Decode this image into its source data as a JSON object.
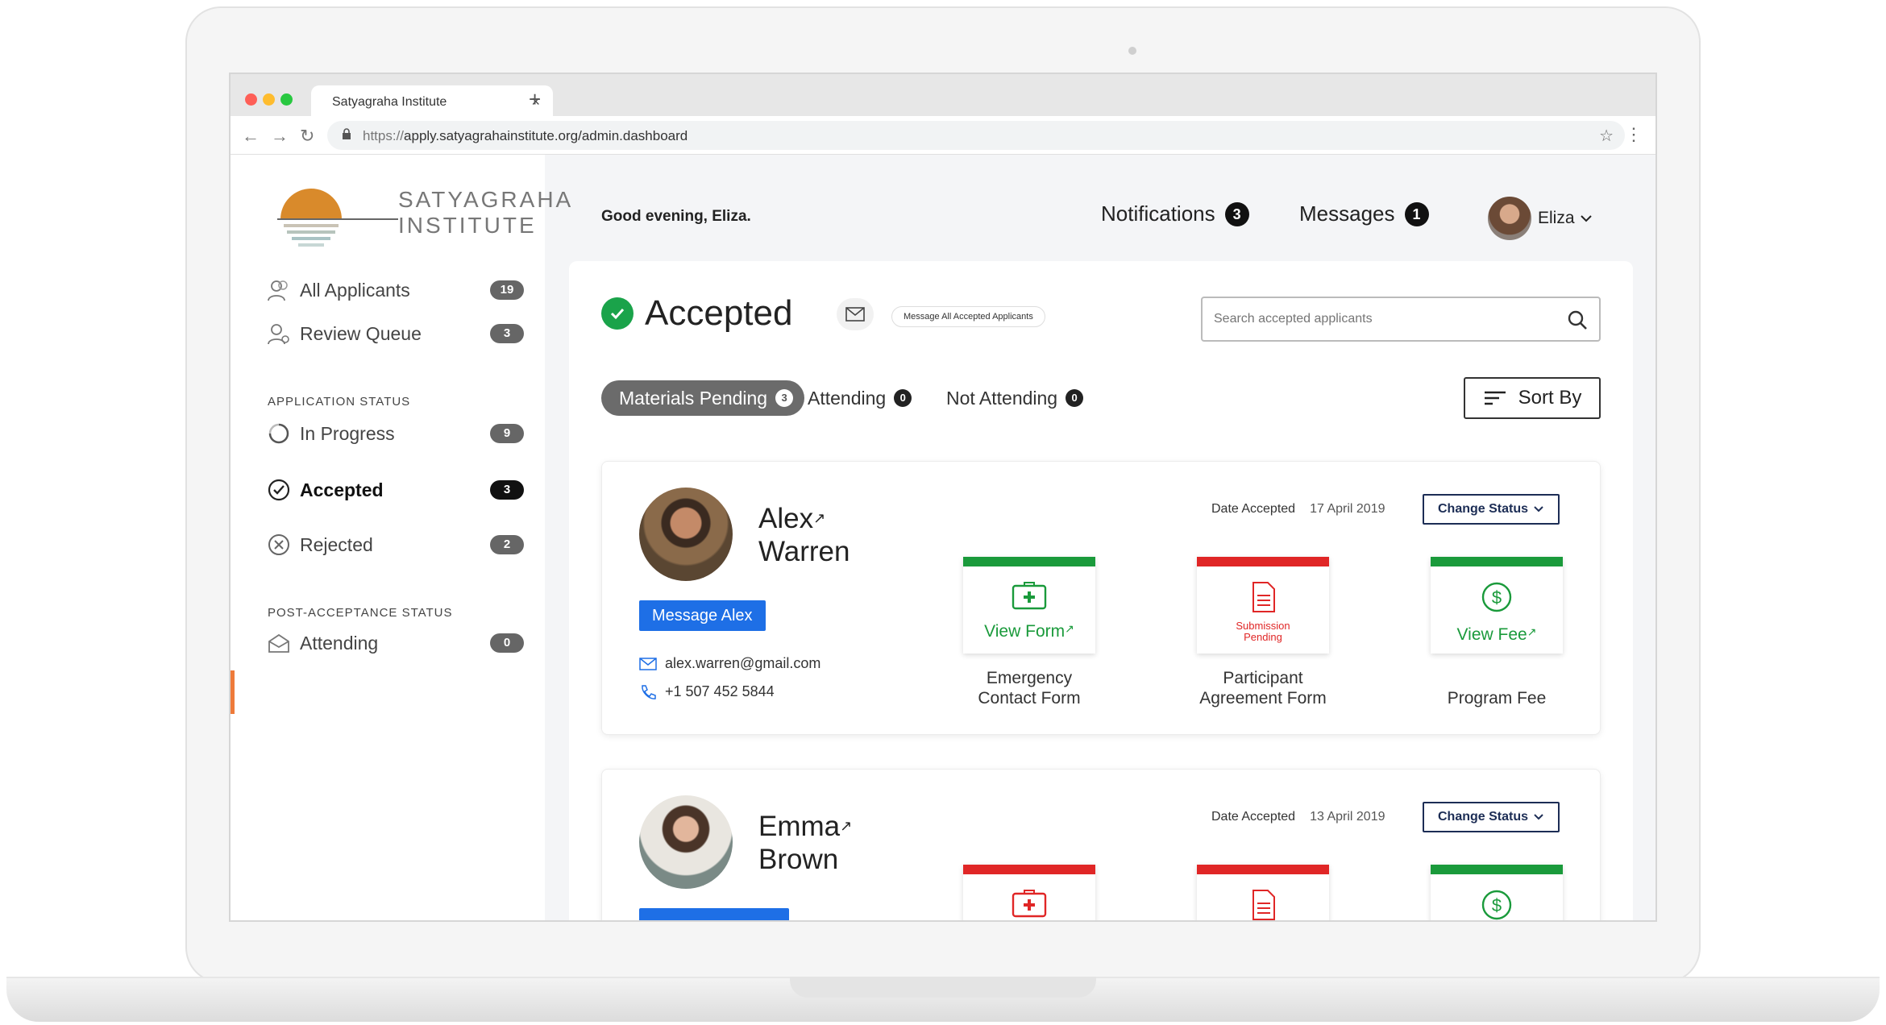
{
  "browser": {
    "tab_title": "Satyagraha Institute",
    "tab_close": "×",
    "new_tab": "+",
    "url_scheme": "https://",
    "url_rest": "apply.satyagrahainstitute.org/admin.dashboard"
  },
  "logo": {
    "line1": "SATYAGRAHA",
    "line2": "INSTITUTE"
  },
  "sidebar": {
    "items": [
      {
        "label": "All Applicants",
        "count": "19",
        "icon": "users-icon"
      },
      {
        "label": "Review Queue",
        "count": "3",
        "icon": "review-user-icon"
      }
    ],
    "application_status_label": "APPLICATION STATUS",
    "status_items": [
      {
        "label": "In Progress",
        "count": "9",
        "icon": "progress-icon"
      },
      {
        "label": "Accepted",
        "count": "3",
        "icon": "check-circle-icon"
      },
      {
        "label": "Rejected",
        "count": "2",
        "icon": "x-circle-icon"
      }
    ],
    "post_acceptance_label": "POST-ACCEPTANCE STATUS",
    "post_items": [
      {
        "label": "Attending",
        "count": "0",
        "icon": "envelope-open-icon"
      }
    ]
  },
  "header": {
    "greeting": "Good evening, Eliza.",
    "notifications_label": "Notifications",
    "notifications_count": "3",
    "messages_label": "Messages",
    "messages_count": "1",
    "user_name": "Eliza"
  },
  "main": {
    "title": "Accepted",
    "message_all_label": "Message All Accepted Applicants",
    "search_placeholder": "Search accepted applicants",
    "filters": [
      {
        "label": "Materials Pending",
        "count": "3"
      },
      {
        "label": "Attending",
        "count": "0"
      },
      {
        "label": "Not Attending",
        "count": "0"
      }
    ],
    "sort_label": "Sort By"
  },
  "applicants": [
    {
      "first": "Alex",
      "last": "Warren",
      "message_label": "Message Alex",
      "email": "alex.warren@gmail.com",
      "phone": "+1 507 452 5844",
      "date_label": "Date Accepted",
      "date": "17 April 2019",
      "change_status": "Change Status",
      "docs": [
        {
          "status": "View Form",
          "caption1": "Emergency",
          "caption2": "Contact Form"
        },
        {
          "status": "Submission Pending",
          "caption1": "Participant",
          "caption2": "Agreement Form"
        },
        {
          "status": "View Fee",
          "caption1": "",
          "caption2": "Program Fee"
        }
      ]
    },
    {
      "first": "Emma",
      "last": "Brown",
      "date_label": "Date Accepted",
      "date": "13 April 2019",
      "change_status": "Change Status"
    }
  ],
  "colors": {
    "accent_orange": "#ee7a3a",
    "green": "#1a9a3b",
    "red": "#e02626",
    "blue": "#1e6fe6",
    "navy": "#1c2d55"
  }
}
